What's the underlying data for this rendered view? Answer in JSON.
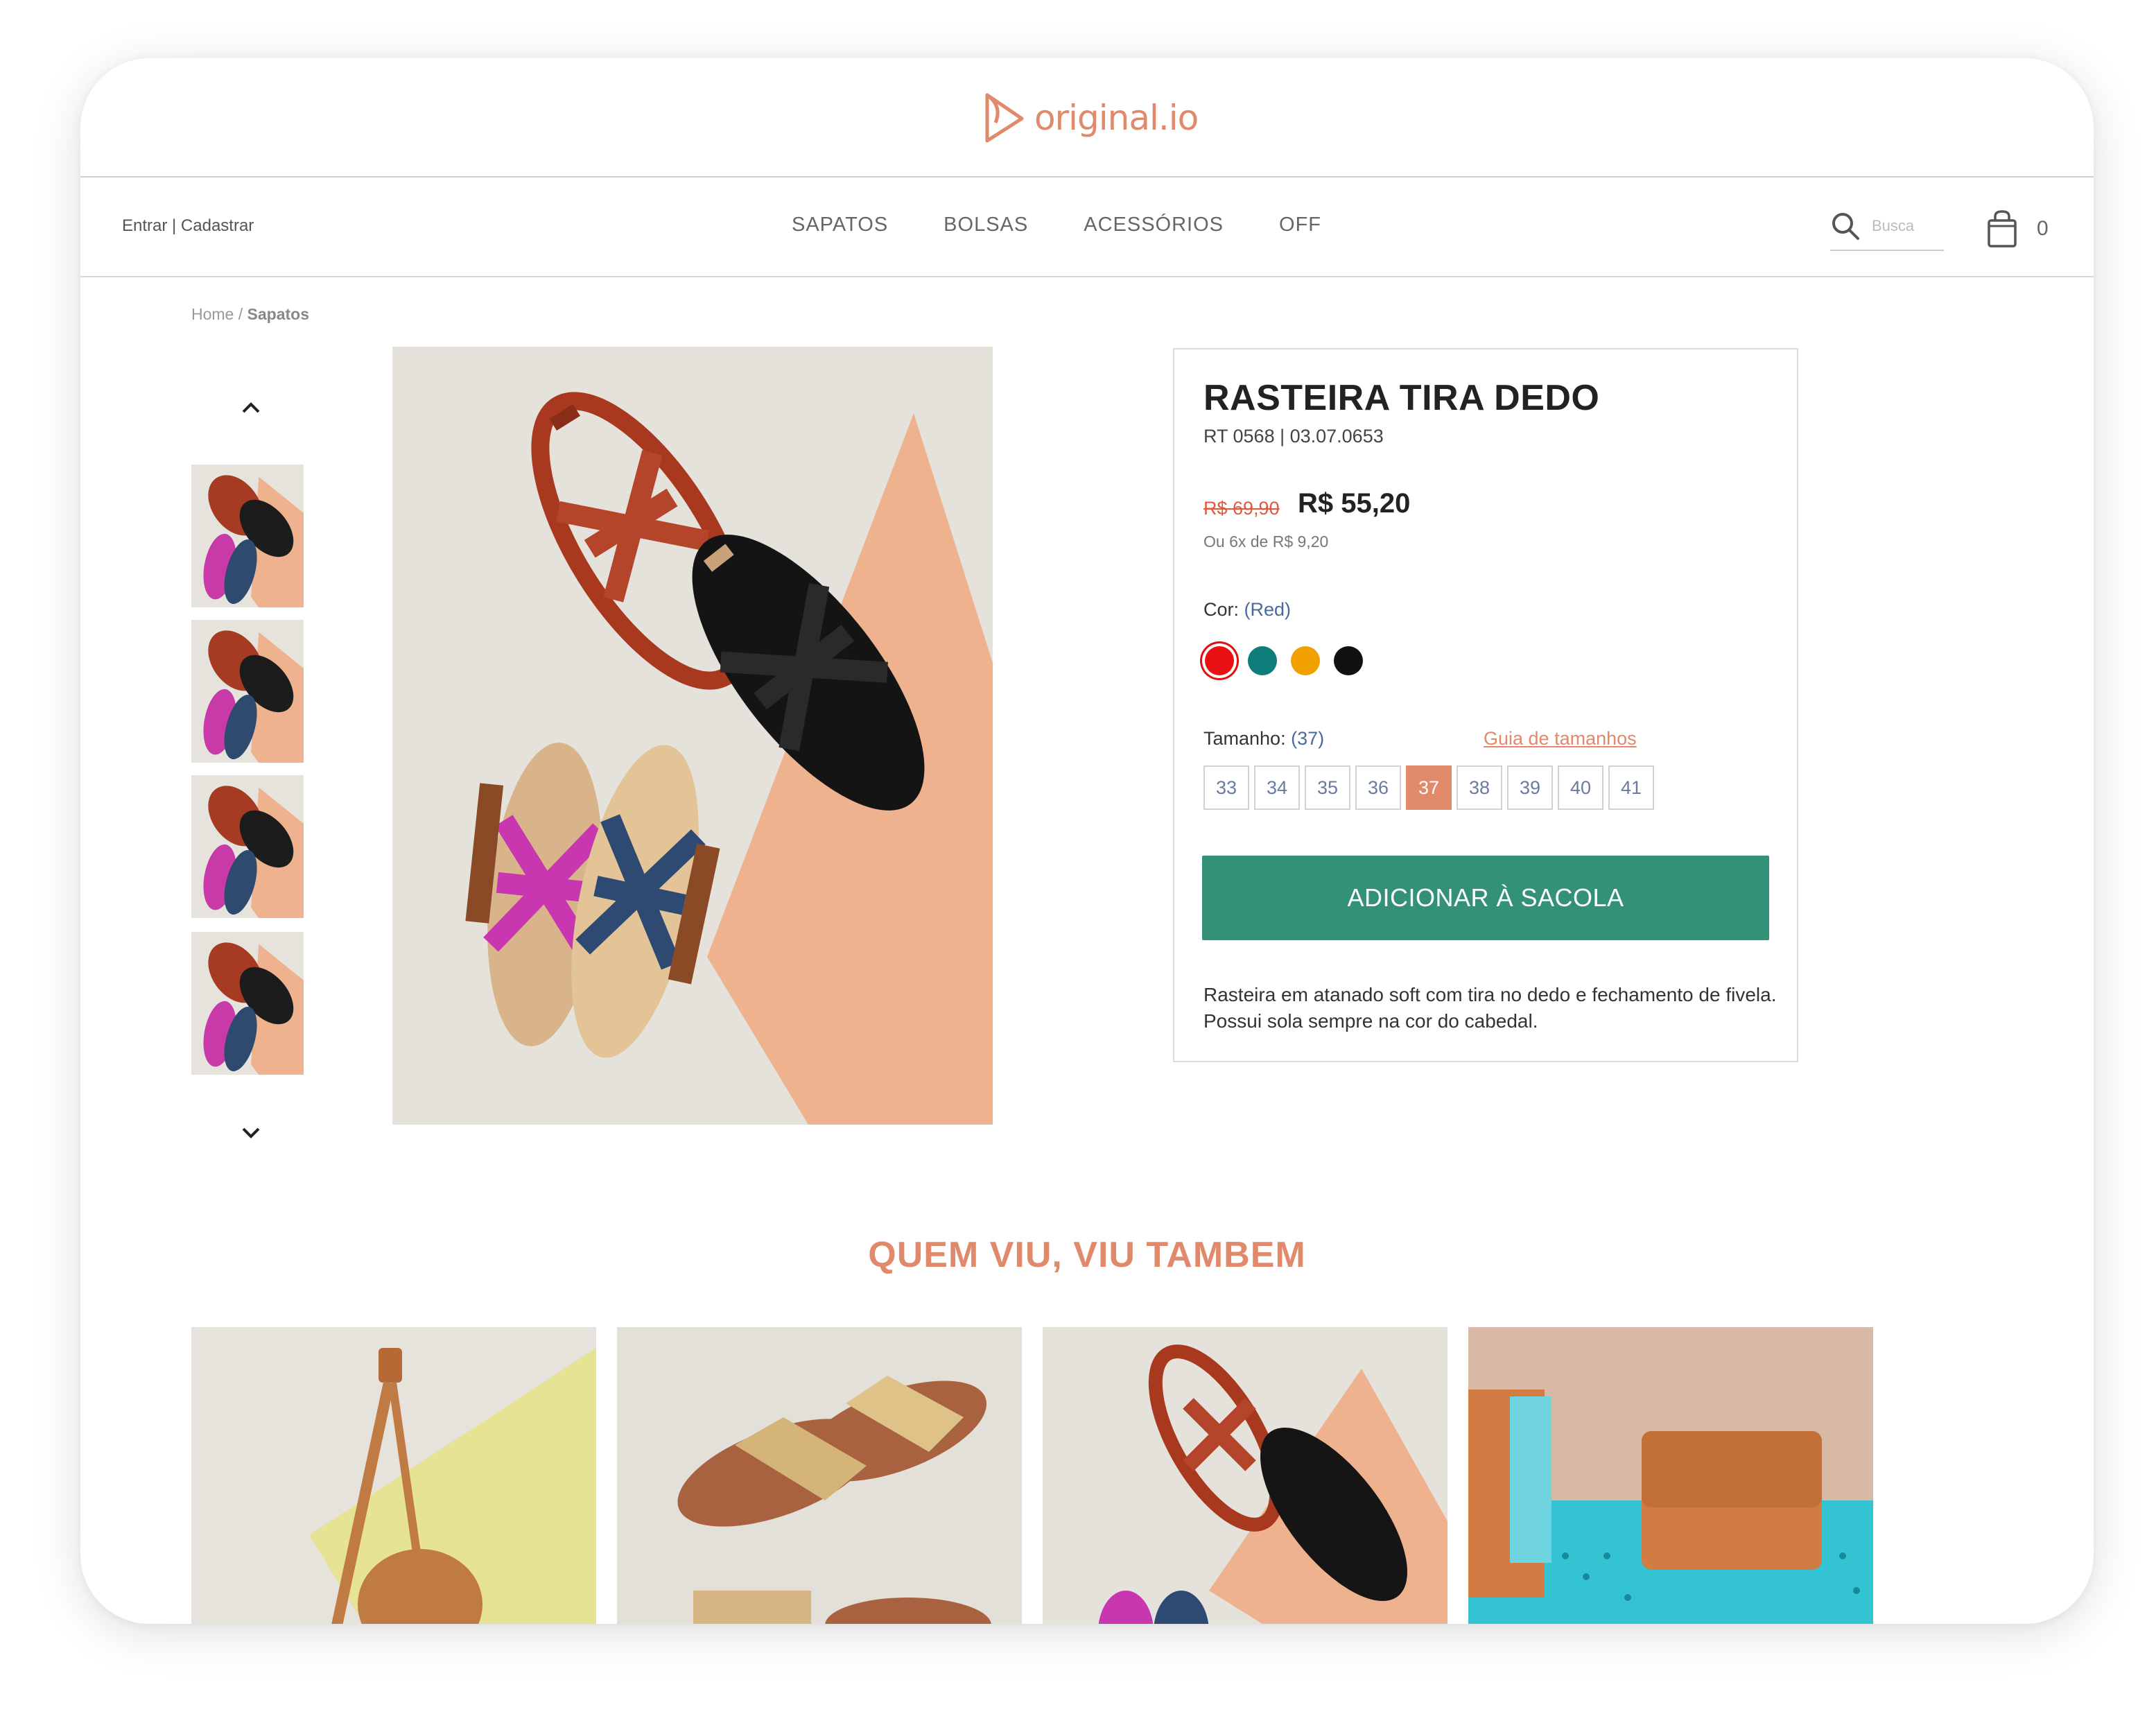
{
  "brand": {
    "logo_text": "original.io",
    "accent": "#e0896b"
  },
  "header": {
    "account_label": "Entrar | Cadastrar",
    "nav": [
      "SAPATOS",
      "BOLSAS",
      "ACESSÓRIOS",
      "OFF"
    ],
    "search_placeholder": "Busca",
    "cart_count": "0"
  },
  "breadcrumb": {
    "home": "Home",
    "separator": "/",
    "current": "Sapatos"
  },
  "gallery": {
    "thumb_count": 4
  },
  "product": {
    "title": "RASTEIRA TIRA DEDO",
    "ref": "RT 0568 | 03.07.0653",
    "old_price": "R$ 69,90",
    "price": "R$ 55,20",
    "installments": "Ou 6x de R$ 9,20",
    "color_label": "Cor:",
    "color_selected": "(Red)",
    "colors": [
      "#e81010",
      "#0f7d7a",
      "#f2a000",
      "#111111"
    ],
    "size_label": "Tamanho:",
    "size_selected": "(37)",
    "size_guide": "Guia de tamanhos",
    "sizes": [
      "33",
      "34",
      "35",
      "36",
      "37",
      "38",
      "39",
      "40",
      "41"
    ],
    "active_size": "37",
    "add_to_bag": "ADICIONAR À SACOLA",
    "description": "Rasteira em atanado soft com tira no dedo e fechamento de fivela. Possui sola sempre na cor do cabedal.",
    "button_color": "#339177"
  },
  "recommendations": {
    "title": "QUEM VIU, VIU TAMBEM"
  }
}
